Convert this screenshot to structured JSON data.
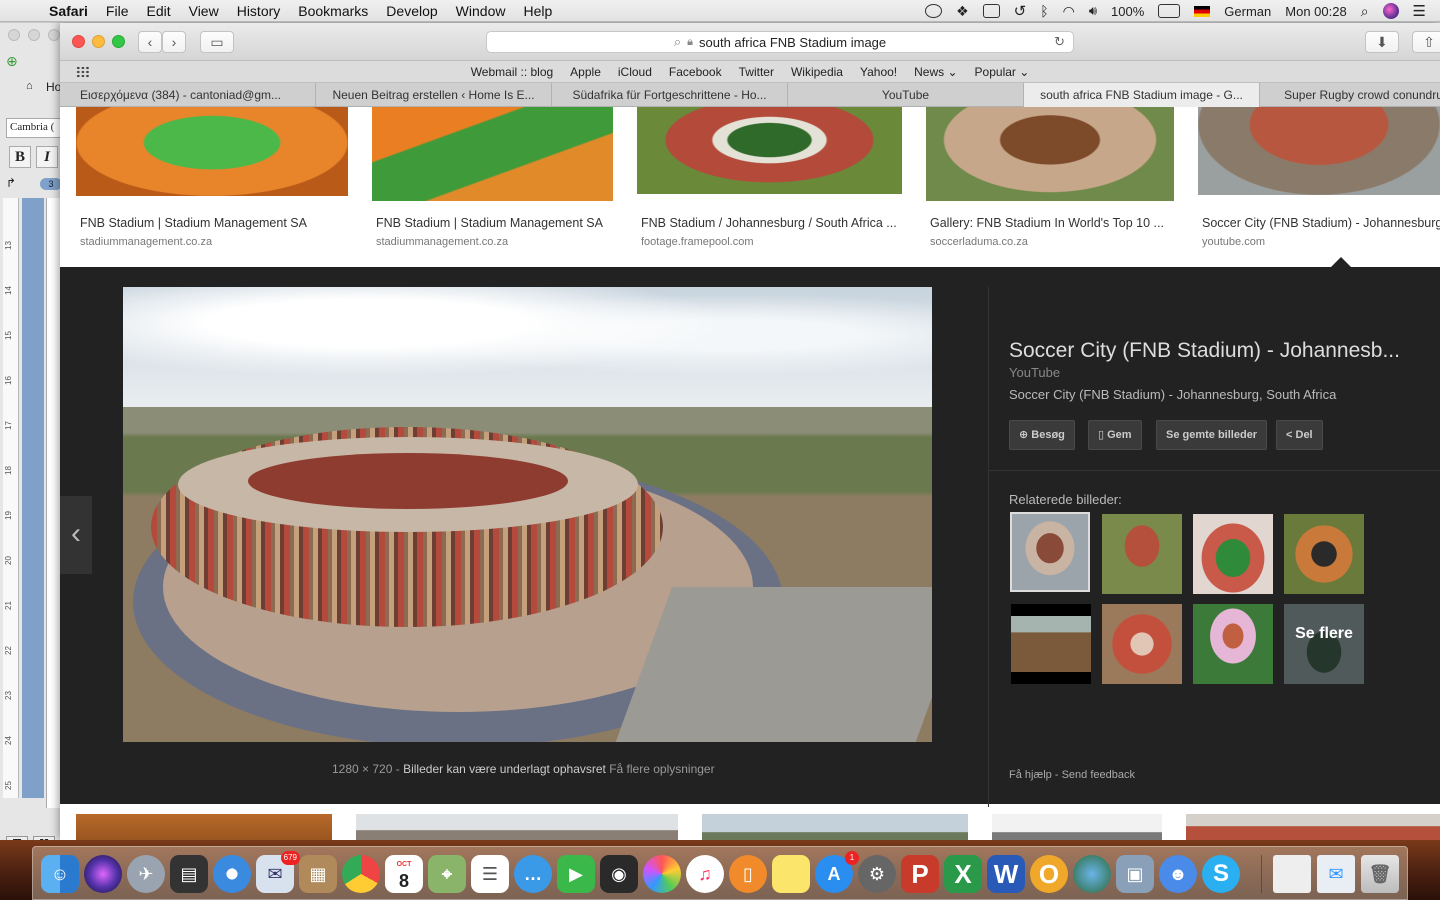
{
  "menubar": {
    "app_name": "Safari",
    "items": [
      "File",
      "Edit",
      "View",
      "History",
      "Bookmarks",
      "Develop",
      "Window",
      "Help"
    ],
    "battery": "100%",
    "input_source": "German",
    "clock": "Mon 00:28"
  },
  "word": {
    "home_tab": "Ho",
    "font_name": "Cambria (",
    "bold": "B",
    "italic": "I",
    "badge": "3",
    "ruler_marks": [
      "13",
      "14",
      "15",
      "16",
      "17",
      "18",
      "19",
      "20",
      "21",
      "22",
      "23",
      "24",
      "25"
    ]
  },
  "safari": {
    "address": "south africa FNB Stadium image",
    "favorites": [
      "Webmail :: blog",
      "Apple",
      "iCloud",
      "Facebook",
      "Twitter",
      "Wikipedia",
      "Yahoo!",
      "News ⌄",
      "Popular ⌄"
    ],
    "tabs": [
      {
        "label": "Εισερχόμενα (384) - cantoniad@gm...",
        "active": false
      },
      {
        "label": "Neuen Beitrag erstellen ‹ Home Is E...",
        "active": false
      },
      {
        "label": "Südafrika für Fortgeschrittene - Ho...",
        "active": false
      },
      {
        "label": "YouTube",
        "active": false
      },
      {
        "label": "south africa FNB Stadium image - G...",
        "active": true
      },
      {
        "label": "Super Rugby crowd conundrum wit",
        "active": false
      }
    ]
  },
  "results": [
    {
      "title": "FNB Stadium | Stadium Management SA",
      "source": "stadiummanagement.co.za"
    },
    {
      "title": "FNB Stadium | Stadium Management SA",
      "source": "stadiummanagement.co.za"
    },
    {
      "title": "FNB Stadium / Johannesburg / South Africa ...",
      "source": "footage.framepool.com"
    },
    {
      "title": "Gallery: FNB Stadium In World's Top 10 ...",
      "source": "soccerladuma.co.za"
    },
    {
      "title": "Soccer City (FNB Stadium) - Johannesburg",
      "source": "youtube.com"
    }
  ],
  "viewer": {
    "title": "Soccer City (FNB Stadium) - Johannesb...",
    "source": "YouTube",
    "description": "Soccer City (FNB Stadium) - Johannesburg, South Africa",
    "actions": [
      "Besøg",
      "Gem",
      "Se gemte billeder",
      "Del"
    ],
    "related_label": "Relaterede billeder:",
    "see_more": "Se flere",
    "dimensions": "1280 × 720",
    "copyright": "Billeder kan være underlagt ophavsret",
    "more_info": "Få flere oplysninger",
    "help": "Få hjælp",
    "feedback": "Send feedback"
  },
  "dock": {
    "mail_badge": "679",
    "calendar_month": "OCT",
    "calendar_day": "8",
    "appstore_badge": "1"
  },
  "colors": {
    "viewer_bg": "#222222",
    "tab_active": "#ececec",
    "close": "#fc5753",
    "minimize": "#fdbc40",
    "maximize": "#33c748"
  }
}
